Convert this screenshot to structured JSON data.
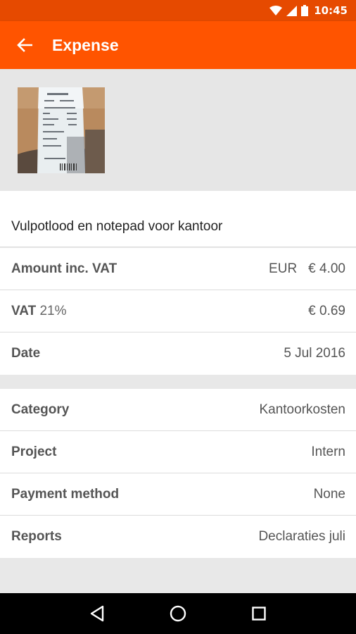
{
  "status_bar": {
    "time": "10:45"
  },
  "app_bar": {
    "title": "Expense"
  },
  "expense": {
    "description": "Vulpotlood en notepad voor kantoor",
    "amount": {
      "label": "Amount inc. VAT",
      "currency": "EUR",
      "value": "€ 4.00"
    },
    "vat": {
      "label": "VAT",
      "rate": "21%",
      "value": "€ 0.69"
    },
    "date": {
      "label": "Date",
      "value": "5 Jul 2016"
    }
  },
  "details": {
    "category": {
      "label": "Category",
      "value": "Kantoorkosten"
    },
    "project": {
      "label": "Project",
      "value": "Intern"
    },
    "payment_method": {
      "label": "Payment method",
      "value": "None"
    },
    "reports": {
      "label": "Reports",
      "value": "Declaraties juli"
    }
  },
  "colors": {
    "status_bar": "#e64a00",
    "app_bar": "#ff5400",
    "background": "#e8e8e8"
  },
  "icons": [
    "wifi-icon",
    "signal-icon",
    "battery-icon",
    "back-arrow-icon",
    "nav-back-icon",
    "nav-home-icon",
    "nav-recents-icon"
  ]
}
